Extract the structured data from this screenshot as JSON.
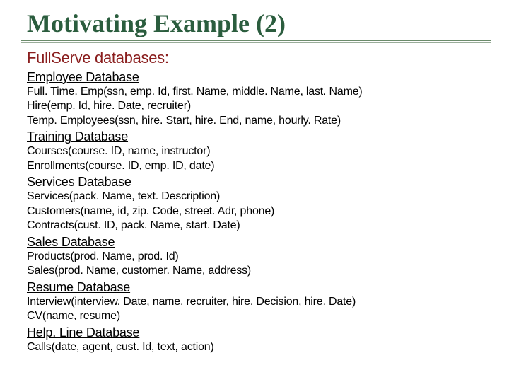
{
  "title": "Motivating Example (2)",
  "subtitle": "FullServe databases:",
  "sections": [
    {
      "heading": "Employee Database",
      "lines": [
        "Full. Time. Emp(ssn, emp. Id, first. Name, middle. Name, last. Name)",
        "Hire(emp. Id, hire. Date, recruiter)",
        "Temp. Employees(ssn, hire. Start, hire. End, name, hourly. Rate)"
      ]
    },
    {
      "heading": "Training Database",
      "lines": [
        "Courses(course. ID, name, instructor)",
        "Enrollments(course. ID, emp. ID, date)"
      ]
    },
    {
      "heading": " Services Database",
      "lines": [
        "Services(pack. Name, text. Description)",
        "Customers(name, id, zip. Code, street. Adr, phone)",
        "Contracts(cust. ID, pack. Name, start. Date)"
      ]
    },
    {
      "heading": "Sales Database",
      "lines": [
        "Products(prod. Name, prod. Id)",
        "Sales(prod. Name, customer. Name, address)"
      ]
    },
    {
      "heading": "Resume Database",
      "lines": [
        "Interview(interview. Date, name, recruiter, hire. Decision, hire. Date)",
        "CV(name, resume)"
      ]
    },
    {
      "heading": "Help. Line Database",
      "lines": [
        "Calls(date, agent, cust. Id, text, action)"
      ]
    }
  ]
}
